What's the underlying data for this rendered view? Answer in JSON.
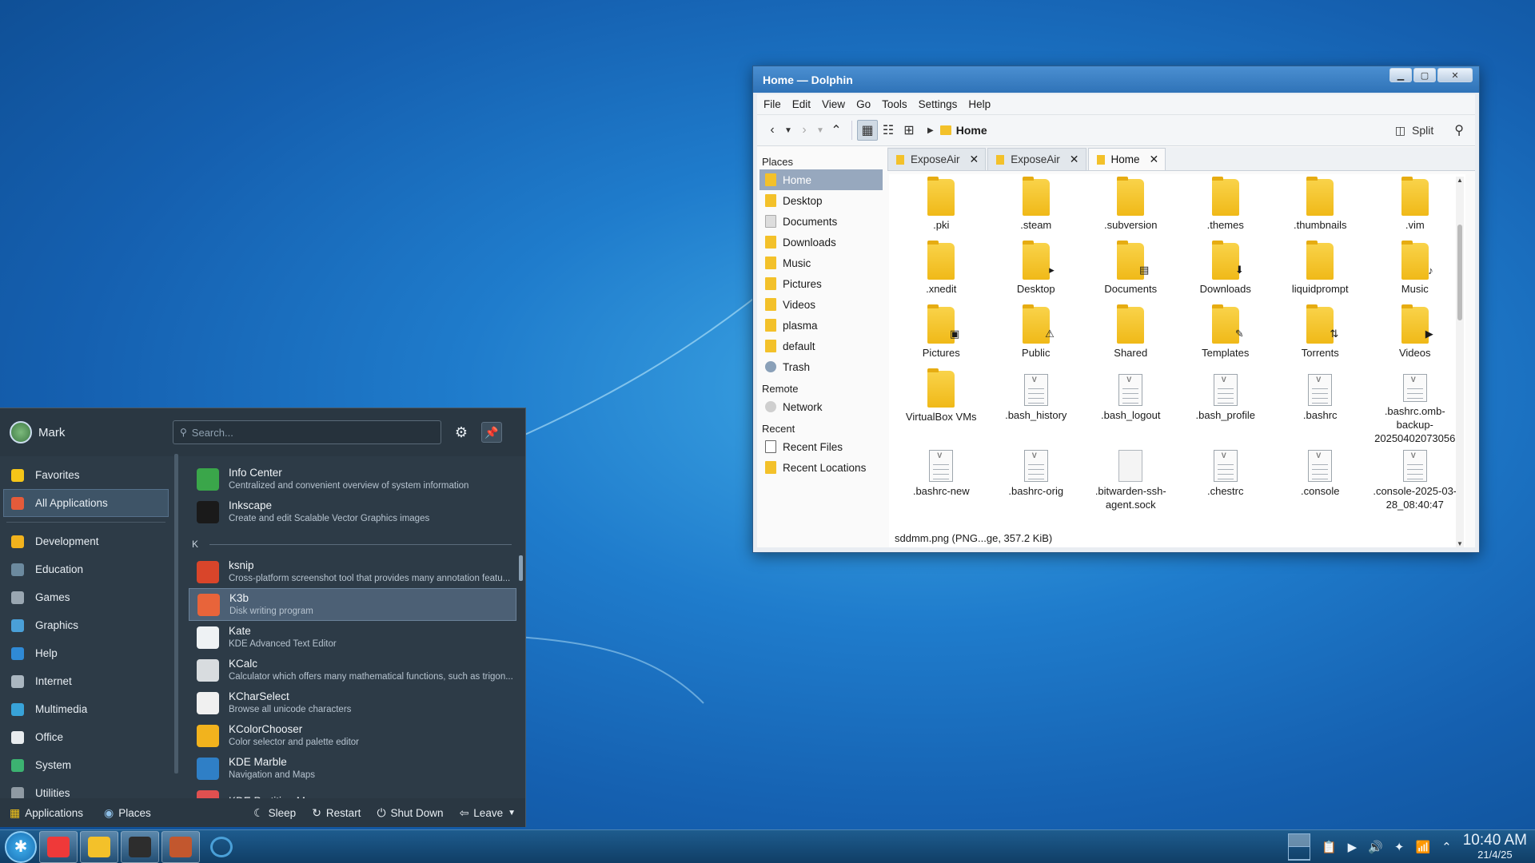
{
  "dolphin": {
    "title": "Home — Dolphin",
    "menu": [
      "File",
      "Edit",
      "View",
      "Go",
      "Tools",
      "Settings",
      "Help"
    ],
    "breadcrumb": "Home",
    "split_label": "Split",
    "places_header": "Places",
    "places": [
      {
        "label": "Home",
        "icon": "home-folder-icon",
        "selected": true
      },
      {
        "label": "Desktop",
        "icon": "desktop-folder-icon"
      },
      {
        "label": "Documents",
        "icon": "documents-folder-icon"
      },
      {
        "label": "Downloads",
        "icon": "downloads-folder-icon"
      },
      {
        "label": "Music",
        "icon": "music-folder-icon"
      },
      {
        "label": "Pictures",
        "icon": "pictures-folder-icon"
      },
      {
        "label": "Videos",
        "icon": "videos-folder-icon"
      },
      {
        "label": "plasma",
        "icon": "folder-icon"
      },
      {
        "label": "default",
        "icon": "folder-icon"
      },
      {
        "label": "Trash",
        "icon": "trash-icon"
      }
    ],
    "remote_header": "Remote",
    "remote": [
      {
        "label": "Network",
        "icon": "network-icon"
      }
    ],
    "recent_header": "Recent",
    "recent": [
      {
        "label": "Recent Files",
        "icon": "recent-files-icon"
      },
      {
        "label": "Recent Locations",
        "icon": "recent-locations-icon"
      }
    ],
    "tabs": [
      {
        "label": "ExposeAir",
        "active": false
      },
      {
        "label": "ExposeAir",
        "active": false
      },
      {
        "label": "Home",
        "active": true
      }
    ],
    "files": [
      {
        "name": ".pki",
        "type": "folder"
      },
      {
        "name": ".steam",
        "type": "folder"
      },
      {
        "name": ".subversion",
        "type": "folder"
      },
      {
        "name": ".themes",
        "type": "folder"
      },
      {
        "name": ".thumbnails",
        "type": "folder"
      },
      {
        "name": ".vim",
        "type": "folder"
      },
      {
        "name": ".xnedit",
        "type": "folder"
      },
      {
        "name": "Desktop",
        "type": "folder",
        "badge": "desktop-badge-icon"
      },
      {
        "name": "Documents",
        "type": "folder",
        "badge": "documents-badge-icon"
      },
      {
        "name": "Downloads",
        "type": "folder",
        "badge": "downloads-badge-icon"
      },
      {
        "name": "liquidprompt",
        "type": "folder"
      },
      {
        "name": "Music",
        "type": "folder",
        "badge": "music-badge-icon"
      },
      {
        "name": "Pictures",
        "type": "folder",
        "badge": "pictures-badge-icon"
      },
      {
        "name": "Public",
        "type": "folder",
        "badge": "public-badge-icon"
      },
      {
        "name": "Shared",
        "type": "folder"
      },
      {
        "name": "Templates",
        "type": "folder",
        "badge": "templates-badge-icon"
      },
      {
        "name": "Torrents",
        "type": "folder",
        "badge": "torrents-badge-icon"
      },
      {
        "name": "Videos",
        "type": "folder",
        "badge": "videos-badge-icon"
      },
      {
        "name": "VirtualBox VMs",
        "type": "folder"
      },
      {
        "name": ".bash_history",
        "type": "doc"
      },
      {
        "name": ".bash_logout",
        "type": "doc"
      },
      {
        "name": ".bash_profile",
        "type": "doc"
      },
      {
        "name": ".bashrc",
        "type": "doc"
      },
      {
        "name": ".bashrc.omb-backup-20250402073056",
        "type": "doc"
      },
      {
        "name": ".bashrc-new",
        "type": "doc"
      },
      {
        "name": ".bashrc-orig",
        "type": "doc"
      },
      {
        "name": ".bitwarden-ssh-agent.sock",
        "type": "sock"
      },
      {
        "name": ".chestrc",
        "type": "doc"
      },
      {
        "name": ".console",
        "type": "doc"
      },
      {
        "name": ".console-2025-03-28_08:40:47",
        "type": "doc"
      }
    ],
    "status": "sddmm.png (PNG...ge, 357.2 KiB)"
  },
  "launcher": {
    "user": "Mark",
    "search_placeholder": "Search...",
    "categories": [
      {
        "label": "Favorites",
        "icon": "star-icon",
        "color": "#f5c518"
      },
      {
        "label": "All Applications",
        "icon": "grid-icon",
        "color": "#e45b3a",
        "selected": true
      },
      {
        "label": "Development",
        "icon": "development-icon",
        "color": "#f2b31d"
      },
      {
        "label": "Education",
        "icon": "education-icon",
        "color": "#6c8a9f"
      },
      {
        "label": "Games",
        "icon": "gamepad-icon",
        "color": "#9aa7b2"
      },
      {
        "label": "Graphics",
        "icon": "graphics-icon",
        "color": "#4aa0d8"
      },
      {
        "label": "Help",
        "icon": "help-icon",
        "color": "#2f8ad6"
      },
      {
        "label": "Internet",
        "icon": "internet-icon",
        "color": "#aab6c0"
      },
      {
        "label": "Multimedia",
        "icon": "multimedia-icon",
        "color": "#38a3d9"
      },
      {
        "label": "Office",
        "icon": "office-icon",
        "color": "#e8ecef"
      },
      {
        "label": "System",
        "icon": "system-gear-icon",
        "color": "#3cb371"
      },
      {
        "label": "Utilities",
        "icon": "utilities-icon",
        "color": "#8f9aa3"
      }
    ],
    "apps_before": [
      {
        "name": "Info Center",
        "desc": "Centralized and convenient overview of system information",
        "icon": "info-center-icon",
        "color": "#3aa64a"
      },
      {
        "name": "Inkscape",
        "desc": "Create and edit Scalable Vector Graphics images",
        "icon": "inkscape-icon",
        "color": "#1a1a1a"
      }
    ],
    "section_letter": "K",
    "apps": [
      {
        "name": "ksnip",
        "desc": "Cross-platform screenshot tool that provides many annotation featu...",
        "icon": "ksnip-icon",
        "color": "#d9452a"
      },
      {
        "name": "K3b",
        "desc": "Disk writing program",
        "icon": "k3b-icon",
        "color": "#e8643a",
        "selected": true
      },
      {
        "name": "Kate",
        "desc": "KDE Advanced Text Editor",
        "icon": "kate-icon",
        "color": "#eef2f4"
      },
      {
        "name": "KCalc",
        "desc": "Calculator which offers many mathematical functions, such as trigon...",
        "icon": "kcalc-icon",
        "color": "#d8dcdf"
      },
      {
        "name": "KCharSelect",
        "desc": "Browse all unicode characters",
        "icon": "kcharselect-icon",
        "color": "#f0f0f0"
      },
      {
        "name": "KColorChooser",
        "desc": "Color selector and palette editor",
        "icon": "kcolorchooser-icon",
        "color": "#f2b31d"
      },
      {
        "name": "KDE Marble",
        "desc": "Navigation and Maps",
        "icon": "marble-icon",
        "color": "#2f7fc6"
      },
      {
        "name": "KDE Partition Manager",
        "desc": "",
        "icon": "partition-manager-icon",
        "color": "#e05050"
      }
    ],
    "footer": {
      "applications": "Applications",
      "places": "Places",
      "sleep": "Sleep",
      "restart": "Restart",
      "shutdown": "Shut Down",
      "leave": "Leave"
    }
  },
  "taskbar": {
    "apps": [
      {
        "icon": "vivaldi-icon",
        "color": "#ef3939"
      },
      {
        "icon": "file-manager-icon",
        "color": "#f3c12a"
      },
      {
        "icon": "terminal-icon",
        "color": "#2d2d2d"
      },
      {
        "icon": "ksnip-taskbar-icon",
        "color": "#c2572e"
      },
      {
        "icon": "app-icon",
        "color": "#4aa0d8"
      }
    ],
    "time": "10:40 AM",
    "date": "21/4/25"
  }
}
